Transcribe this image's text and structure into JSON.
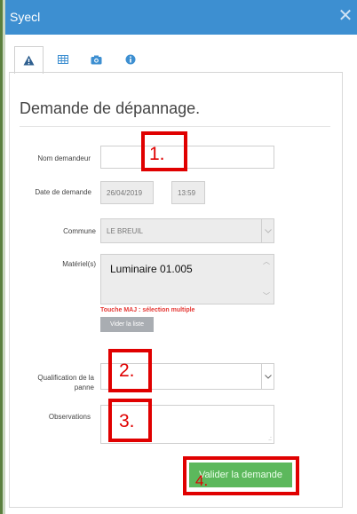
{
  "window": {
    "title": "Syecl"
  },
  "tabs": [
    {
      "icon": "warning-icon"
    },
    {
      "icon": "grid-icon"
    },
    {
      "icon": "camera-icon"
    },
    {
      "icon": "info-icon"
    }
  ],
  "form": {
    "heading": "Demande de dépannage.",
    "nom_demandeur": {
      "label": "Nom demandeur",
      "value": ""
    },
    "date_demande": {
      "label": "Date de demande",
      "date": "26/04/2019",
      "time": "13:59"
    },
    "commune": {
      "label": "Commune",
      "value": "LE BREUIL"
    },
    "materiels": {
      "label": "Matériel(s)",
      "selected": "Luminaire 01.005",
      "hint": "Touche MAJ : sélection multiple",
      "clear_button": "Vider la liste"
    },
    "qualification": {
      "label": "Qualification de la panne",
      "value": ""
    },
    "observations": {
      "label": "Observations",
      "value": ""
    },
    "submit_button": "Valider la demande"
  },
  "annotations": [
    "1.",
    "2.",
    "3.",
    "4."
  ],
  "colors": {
    "titlebar": "#3d8fd1",
    "submit": "#5cb85c",
    "annotation": "#e00000",
    "hint": "#e53935"
  }
}
